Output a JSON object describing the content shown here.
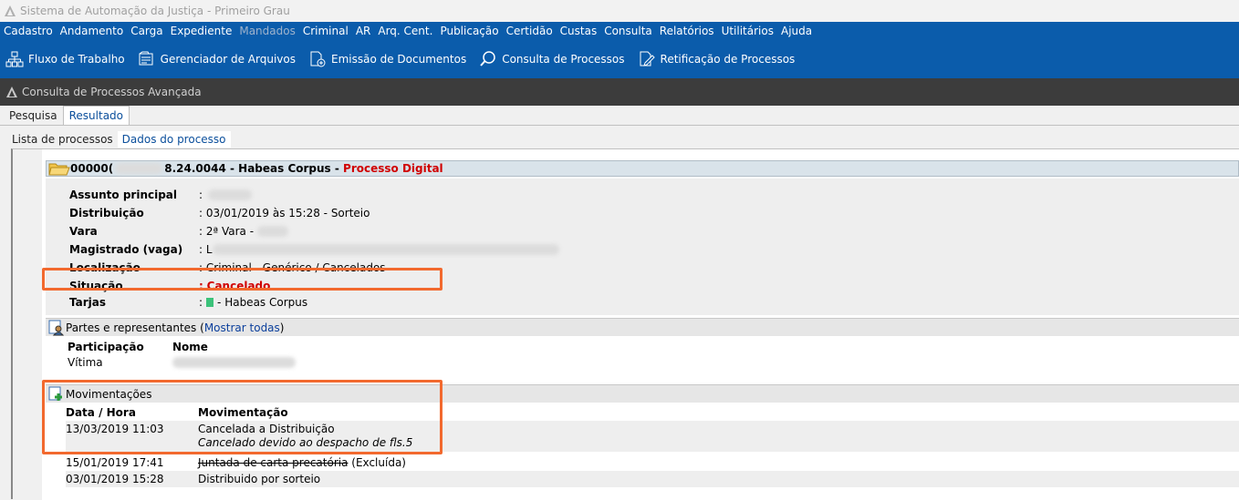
{
  "window": {
    "title": "Sistema de Automação da Justiça - Primeiro Grau"
  },
  "menu": [
    {
      "label": "Cadastro",
      "disabled": false
    },
    {
      "label": "Andamento",
      "disabled": false
    },
    {
      "label": "Carga",
      "disabled": false
    },
    {
      "label": "Expediente",
      "disabled": false
    },
    {
      "label": "Mandados",
      "disabled": true
    },
    {
      "label": "Criminal",
      "disabled": false
    },
    {
      "label": "AR",
      "disabled": false
    },
    {
      "label": "Arq. Cent.",
      "disabled": false
    },
    {
      "label": "Publicação",
      "disabled": false
    },
    {
      "label": "Certidão",
      "disabled": false
    },
    {
      "label": "Custas",
      "disabled": false
    },
    {
      "label": "Consulta",
      "disabled": false
    },
    {
      "label": "Relatórios",
      "disabled": false
    },
    {
      "label": "Utilitários",
      "disabled": false
    },
    {
      "label": "Ajuda",
      "disabled": false
    }
  ],
  "toolbar": [
    {
      "label": "Fluxo de Trabalho",
      "icon": "workflow-icon"
    },
    {
      "label": "Gerenciador de Arquivos",
      "icon": "file-manager-icon"
    },
    {
      "label": "Emissão de Documentos",
      "icon": "document-emission-icon"
    },
    {
      "label": "Consulta de Processos",
      "icon": "process-search-icon"
    },
    {
      "label": "Retificação de Processos",
      "icon": "process-rectify-icon"
    }
  ],
  "subwindow": {
    "title": "Consulta de Processos Avançada"
  },
  "tabs": {
    "search": "Pesquisa",
    "result": "Resultado"
  },
  "subtabs": {
    "list": "Lista de processos",
    "data": "Dados do processo"
  },
  "process": {
    "number_prefix": "00000(",
    "number_suffix": "8.24.0044",
    "class": "Habeas Corpus",
    "separator": " - ",
    "digital": "Processo Digital"
  },
  "details": {
    "assunto": {
      "label": "Assunto principal",
      "value": ""
    },
    "distribuicao": {
      "label": "Distribuição",
      "value": "03/01/2019 às 15:28 - Sorteio"
    },
    "vara": {
      "label": "Vara",
      "value": "2ª Vara - "
    },
    "magistrado": {
      "label": "Magistrado (vaga)",
      "value": "L"
    },
    "localizacao": {
      "label": "Localização",
      "value": "Criminal - Genérico / Cancelados"
    },
    "situacao": {
      "label": "Situação",
      "value": "Cancelado"
    },
    "tarjas": {
      "label": "Tarjas",
      "value": "- Habeas Corpus",
      "color": "#3cc27a"
    },
    "colon": ":"
  },
  "partes": {
    "title": "Partes e representantes",
    "show_all_open": "(",
    "show_all": "Mostrar todas",
    "show_all_close": ")",
    "col_participacao": "Participação",
    "col_nome": "Nome",
    "rows": [
      {
        "participacao": "Vítima",
        "nome": ""
      }
    ]
  },
  "movimentacoes": {
    "title": "Movimentações",
    "col_data": "Data / Hora",
    "col_mov": "Movimentação",
    "rows": [
      {
        "data": "13/03/2019 11:03",
        "mov": "Cancelada a Distribuição",
        "note": "Cancelado devido ao despacho de fls.5"
      },
      {
        "data": "15/01/2019 17:41",
        "mov": "Juntada de carta precatória",
        "note": "(Excluída)"
      },
      {
        "data": "03/01/2019 15:28",
        "mov": "Distribuido por sorteio",
        "note": ""
      }
    ]
  },
  "colors": {
    "menu_bg": "#0b5cab",
    "highlight": "#f2692e",
    "status_red": "#d00000"
  }
}
